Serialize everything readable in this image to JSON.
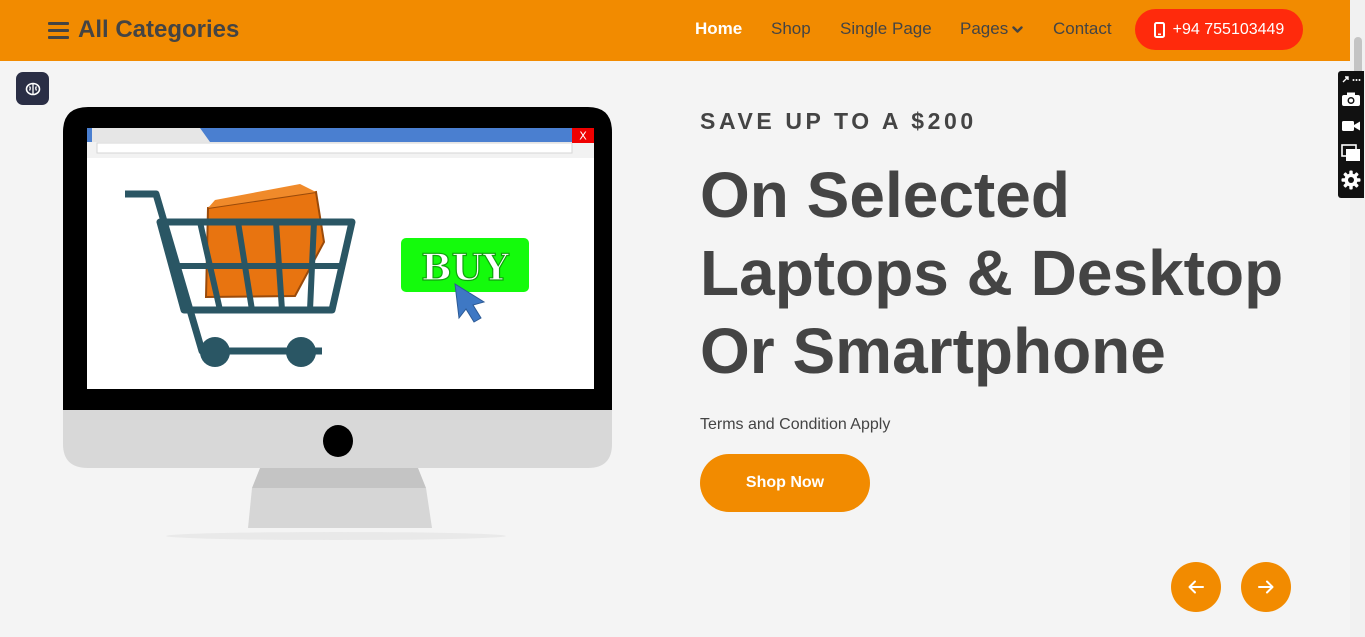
{
  "header": {
    "categories_label": "All Categories",
    "nav": [
      {
        "label": "Home",
        "active": true
      },
      {
        "label": "Shop",
        "active": false
      },
      {
        "label": "Single Page",
        "active": false
      },
      {
        "label": "Pages",
        "active": false,
        "has_dropdown": true
      },
      {
        "label": "Contact",
        "active": false
      }
    ],
    "phone": "+94 755103449"
  },
  "hero": {
    "eyebrow": "SAVE UP TO A $200",
    "headline": "On Selected Laptops & Desktop Or Smartphone",
    "terms": "Terms and Condition Apply",
    "cta": "Shop Now",
    "image_text": {
      "buy": "BUY",
      "close": "X"
    }
  },
  "icons": {
    "menu": "bars-icon",
    "phone": "mobile-phone-icon",
    "dropdown": "chevron-down-icon",
    "extension": "brain-icon",
    "prev": "arrow-left-icon",
    "next": "arrow-right-icon",
    "tools": [
      "link-icon",
      "more-icon",
      "camera-icon",
      "video-icon",
      "windows-icon",
      "gear-icon"
    ]
  },
  "colors": {
    "brand_orange": "#f28b00",
    "phone_red": "#ff2a0c",
    "text_dark": "#444444",
    "background": "#f4f4f4",
    "buy_green": "#14fb0c"
  }
}
